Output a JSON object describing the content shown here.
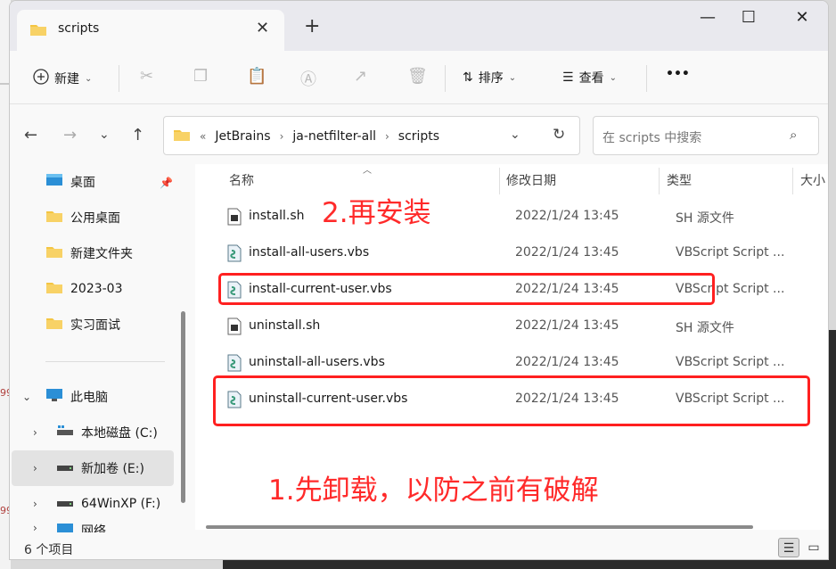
{
  "window": {
    "tab_title": "scripts",
    "close_tab": "✕",
    "new_tab": "+",
    "minimize": "—",
    "maximize": "☐",
    "close": "✕"
  },
  "toolbar": {
    "new_label": "新建",
    "sort_label": "排序",
    "view_label": "查看",
    "more": "•••"
  },
  "address": {
    "prefix": "«",
    "crumbs": [
      "JetBrains",
      "ja-netfilter-all",
      "scripts"
    ],
    "search_placeholder": "在 scripts 中搜索"
  },
  "sidebar": {
    "items": [
      {
        "label": "桌面",
        "icon": "desktop-icon"
      },
      {
        "label": "公用桌面",
        "icon": "folder-icon"
      },
      {
        "label": "新建文件夹",
        "icon": "folder-icon"
      },
      {
        "label": "2023-03",
        "icon": "folder-icon"
      },
      {
        "label": "实习面试",
        "icon": "folder-icon"
      },
      {
        "label": "此电脑",
        "icon": "computer-icon"
      },
      {
        "label": "本地磁盘 (C:)",
        "icon": "drive-icon"
      },
      {
        "label": "新加卷 (E:)",
        "icon": "drive-icon"
      },
      {
        "label": "64WinXP  (F:)",
        "icon": "drive-icon"
      },
      {
        "label": "网络",
        "icon": "network-icon"
      }
    ]
  },
  "columns": {
    "name": "名称",
    "date": "修改日期",
    "type": "类型",
    "size": "大小"
  },
  "files": [
    {
      "name": "install.sh",
      "date": "2022/1/24 13:45",
      "type": "SH 源文件",
      "icon": "sh-file-icon"
    },
    {
      "name": "install-all-users.vbs",
      "date": "2022/1/24 13:45",
      "type": "VBScript Script ...",
      "icon": "vbs-file-icon"
    },
    {
      "name": "install-current-user.vbs",
      "date": "2022/1/24 13:45",
      "type": "VBScript Script ...",
      "icon": "vbs-file-icon"
    },
    {
      "name": "uninstall.sh",
      "date": "2022/1/24 13:45",
      "type": "SH 源文件",
      "icon": "sh-file-icon"
    },
    {
      "name": "uninstall-all-users.vbs",
      "date": "2022/1/24 13:45",
      "type": "VBScript Script ...",
      "icon": "vbs-file-icon"
    },
    {
      "name": "uninstall-current-user.vbs",
      "date": "2022/1/24 13:45",
      "type": "VBScript Script ...",
      "icon": "vbs-file-icon"
    }
  ],
  "annotations": {
    "step2": "2.再安装",
    "step1": "1.先卸载，以防之前有破解"
  },
  "status": {
    "count": "6 个项目"
  },
  "colors": {
    "annotation_red": "#ff2020",
    "folder_yellow": "#f4c542"
  },
  "background": {
    "left_marks": [
      "99",
      "99"
    ]
  }
}
